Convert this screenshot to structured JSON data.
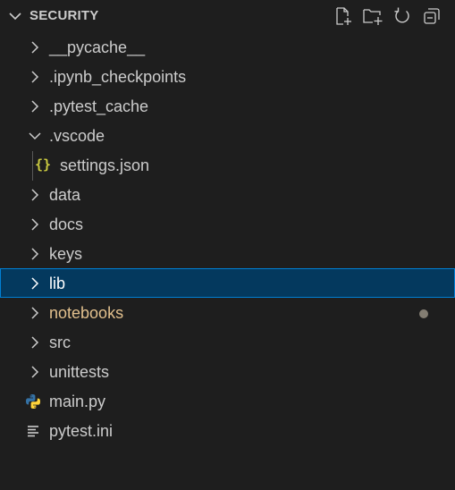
{
  "explorer": {
    "title": "SECURITY",
    "actions": [
      {
        "name": "new-file-icon"
      },
      {
        "name": "new-folder-icon"
      },
      {
        "name": "refresh-icon"
      },
      {
        "name": "collapse-all-icon"
      }
    ]
  },
  "tree": [
    {
      "label": "__pycache__",
      "type": "folder",
      "expanded": false
    },
    {
      "label": ".ipynb_checkpoints",
      "type": "folder",
      "expanded": false
    },
    {
      "label": ".pytest_cache",
      "type": "folder",
      "expanded": false
    },
    {
      "label": ".vscode",
      "type": "folder",
      "expanded": true
    },
    {
      "label": "settings.json",
      "type": "file",
      "icon": "json-braces-icon",
      "icon_text": "{}"
    },
    {
      "label": "data",
      "type": "folder",
      "expanded": false
    },
    {
      "label": "docs",
      "type": "folder",
      "expanded": false
    },
    {
      "label": "keys",
      "type": "folder",
      "expanded": false
    },
    {
      "label": "lib",
      "type": "folder",
      "expanded": false,
      "selected": true
    },
    {
      "label": "notebooks",
      "type": "folder",
      "expanded": false,
      "modified": true
    },
    {
      "label": "src",
      "type": "folder",
      "expanded": false
    },
    {
      "label": "unittests",
      "type": "folder",
      "expanded": false
    },
    {
      "label": "main.py",
      "type": "file",
      "icon": "python-icon"
    },
    {
      "label": "pytest.ini",
      "type": "file",
      "icon": "settings-file-icon"
    }
  ],
  "colors": {
    "background": "#1e1e1e",
    "text": "#cccccc",
    "selected_bg": "#04395e",
    "selected_border": "#007fd4",
    "modified_text": "#e2c08d",
    "json_icon": "#cbcb41",
    "python_blue": "#3572a5",
    "python_yellow": "#ffd43b"
  }
}
